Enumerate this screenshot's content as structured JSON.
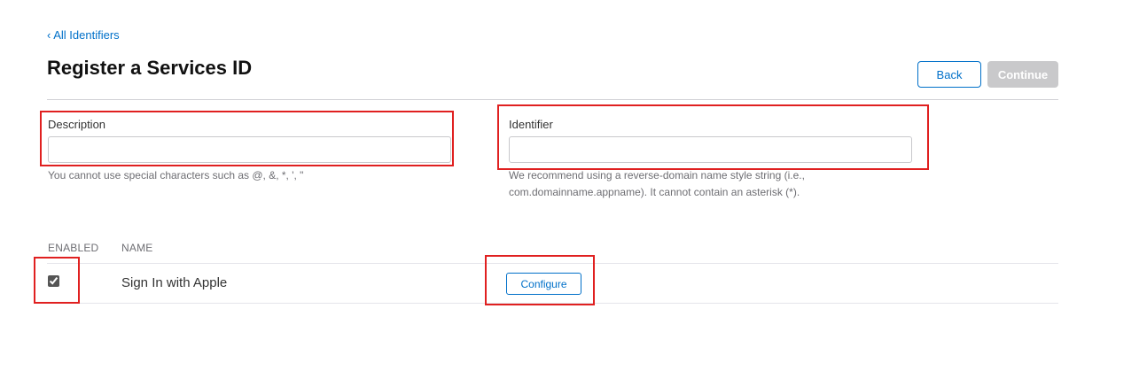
{
  "nav": {
    "back_link": "‹ All Identifiers"
  },
  "header": {
    "title": "Register a Services ID",
    "back_button": "Back",
    "continue_button": "Continue"
  },
  "form": {
    "description": {
      "label": "Description",
      "value": "",
      "hint": "You cannot use special characters such as @, &, *, ', \""
    },
    "identifier": {
      "label": "Identifier",
      "value": "",
      "hint_line1": "We recommend using a reverse-domain name style string (i.e.,",
      "hint_line2": "com.domainname.appname). It cannot contain an asterisk (*)."
    }
  },
  "capabilities": {
    "columns": {
      "enabled": "ENABLED",
      "name": "NAME"
    },
    "rows": [
      {
        "enabled": true,
        "name": "Sign In with Apple",
        "action": "Configure"
      }
    ]
  },
  "colors": {
    "accent": "#0070c9",
    "highlight": "#e02020",
    "disabled": "#c9c9cb"
  }
}
